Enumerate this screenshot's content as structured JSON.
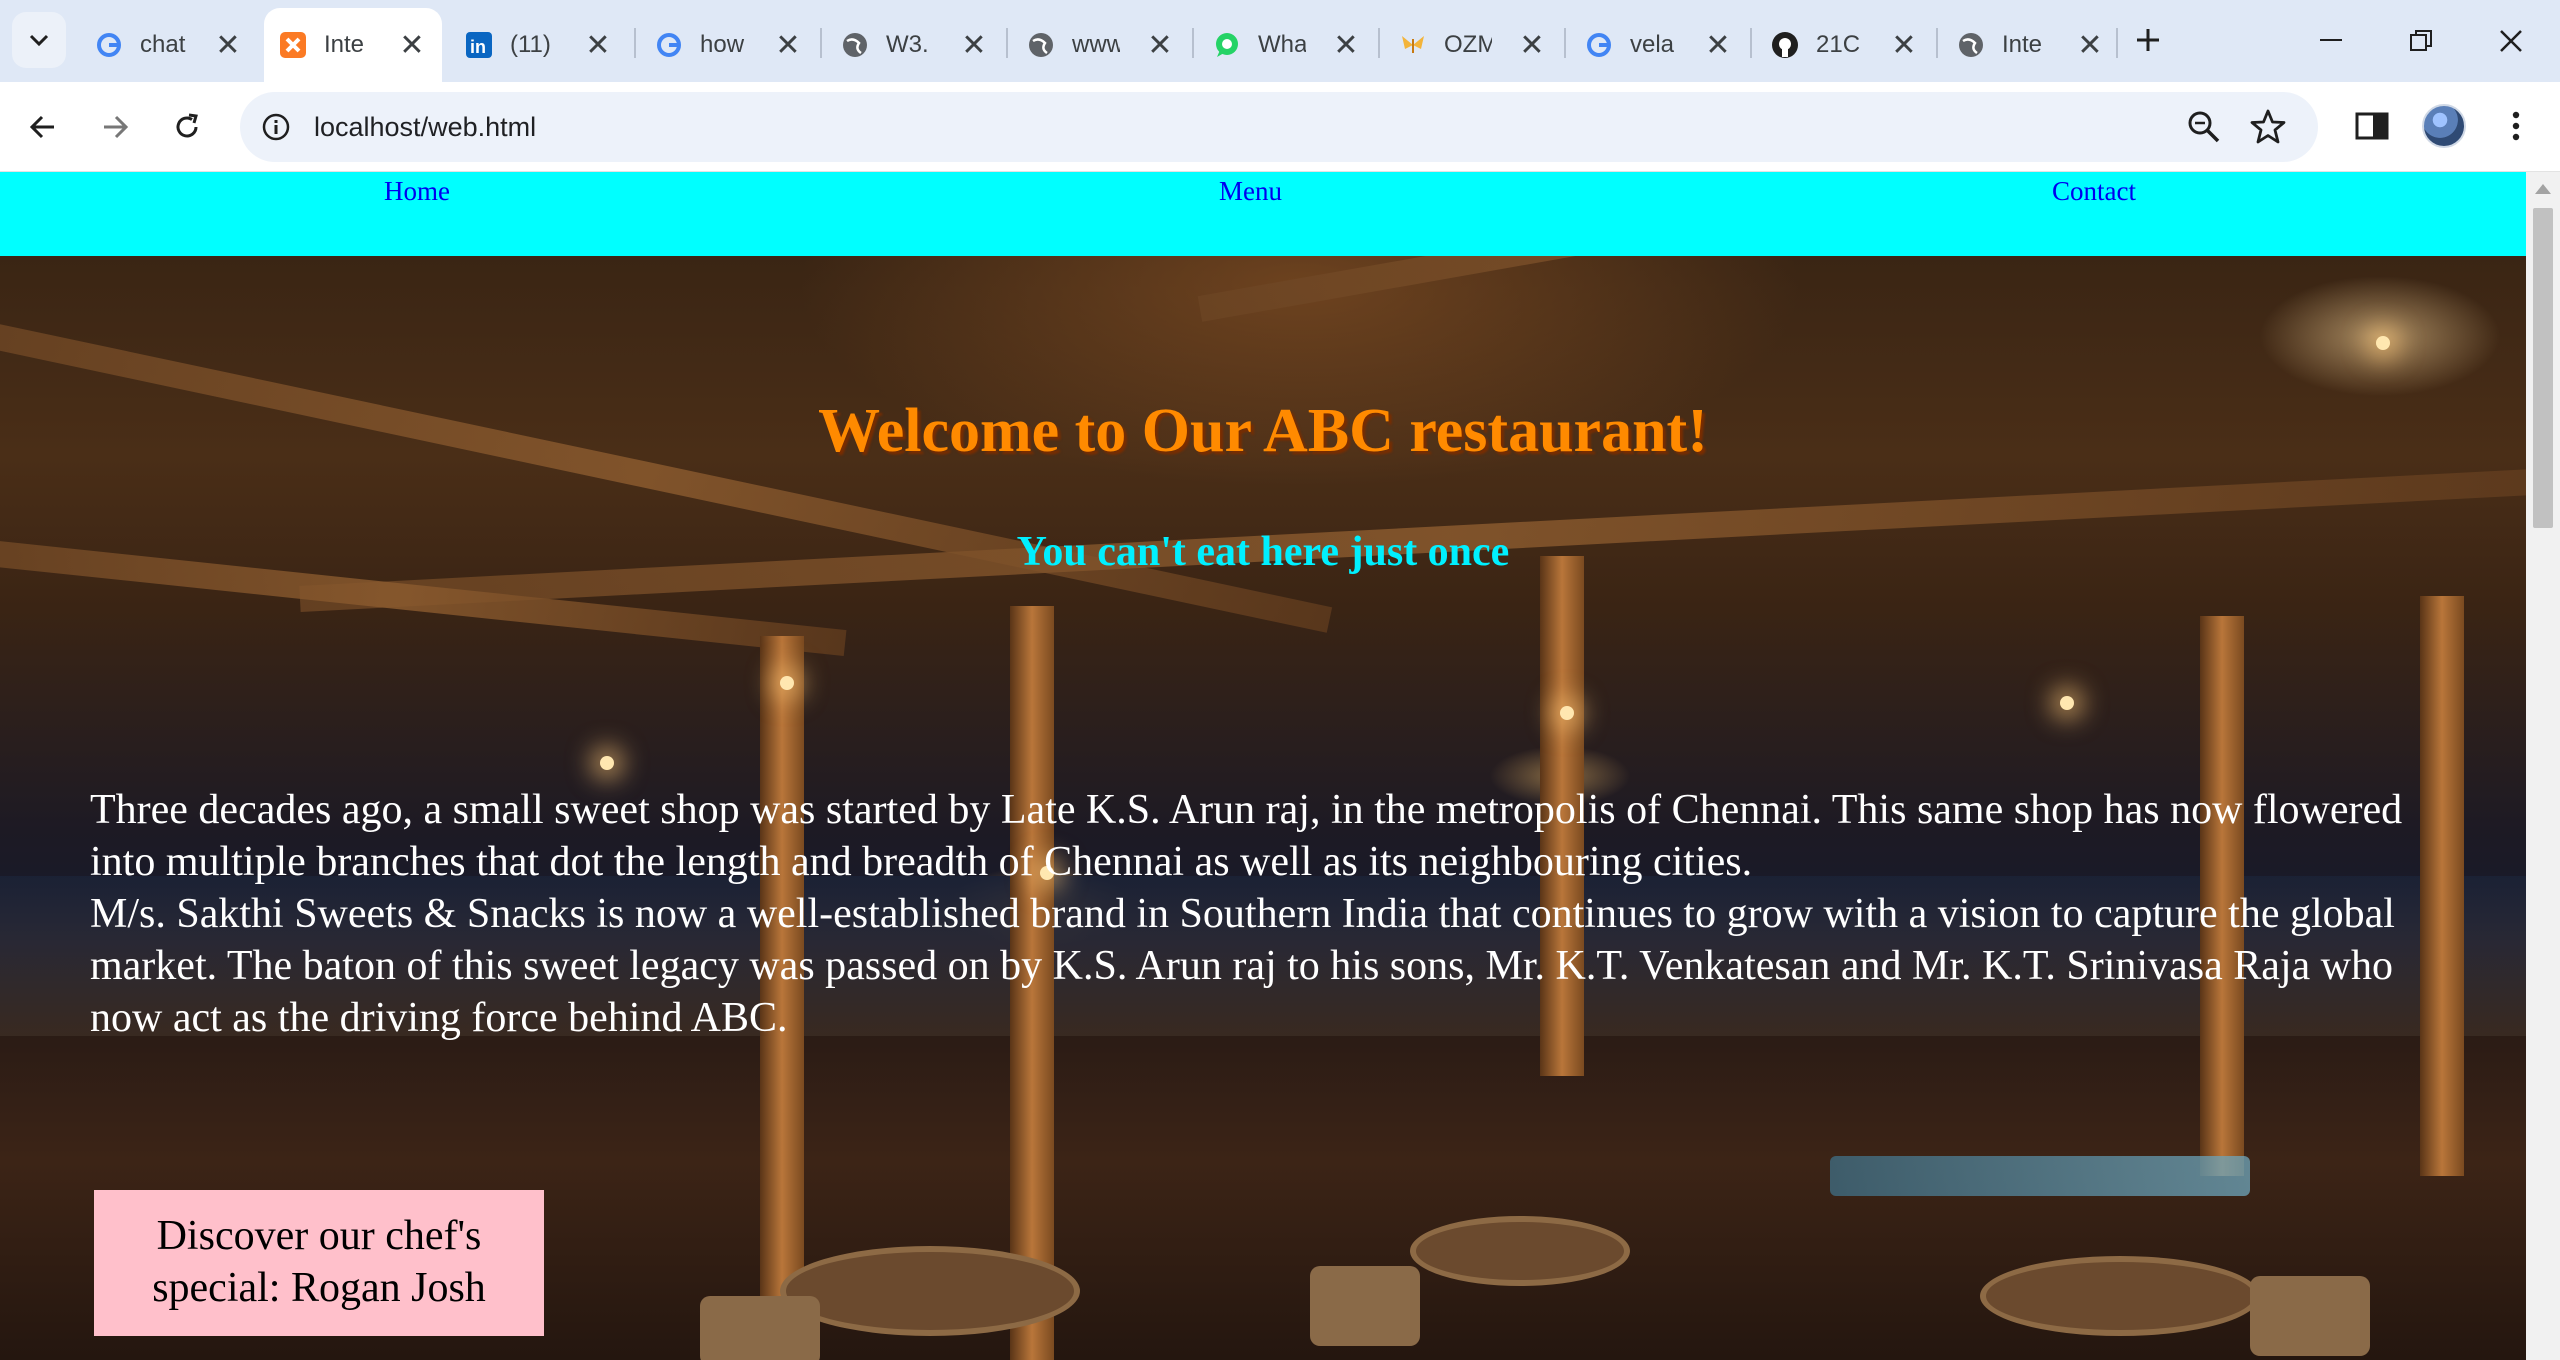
{
  "browser": {
    "tabs": [
      {
        "title": "chat",
        "icon": "google-icon"
      },
      {
        "title": "Inte",
        "icon": "xampp-icon",
        "active": true
      },
      {
        "title": "(11)",
        "icon": "linkedin-icon"
      },
      {
        "title": "how",
        "icon": "google-icon"
      },
      {
        "title": "W3.",
        "icon": "globe-icon"
      },
      {
        "title": "www",
        "icon": "globe-icon"
      },
      {
        "title": "Wha",
        "icon": "whatsapp-icon"
      },
      {
        "title": "OZM",
        "icon": "butterfly-icon"
      },
      {
        "title": "vela",
        "icon": "google-icon"
      },
      {
        "title": "21C",
        "icon": "github-icon"
      },
      {
        "title": "Inte",
        "icon": "globe-icon"
      }
    ],
    "url": "localhost/web.html"
  },
  "site": {
    "nav": {
      "home": "Home",
      "menu": "Menu",
      "contact": "Contact"
    },
    "hero": {
      "title": "Welcome to Our ABC restaurant!",
      "tagline": "You can't eat here just once",
      "story_line1": "Three decades ago, a small sweet shop was started by Late K.S. Arun raj, in the metropolis of Chennai. This same shop has now flowered into multiple branches that dot the length and breadth of Chennai as well as its neighbouring cities.",
      "story_line2": "M/s. Sakthi Sweets & Snacks is now a well-established brand in Southern India that continues to grow with a vision to capture the global market. The baton of this sweet legacy was passed on by K.S. Arun raj to his sons, Mr. K.T. Venkatesan and Mr. K.T. Srinivasa Raja who now act as the driving force behind ABC.",
      "special_line1": "Discover our chef's",
      "special_line2": "special: Rogan Josh"
    }
  },
  "colors": {
    "nav_bg": "#00ffff",
    "link": "#0000ee",
    "title": "#ff8a00",
    "tagline": "#00f0ff",
    "special_bg": "#ffc0cb"
  }
}
